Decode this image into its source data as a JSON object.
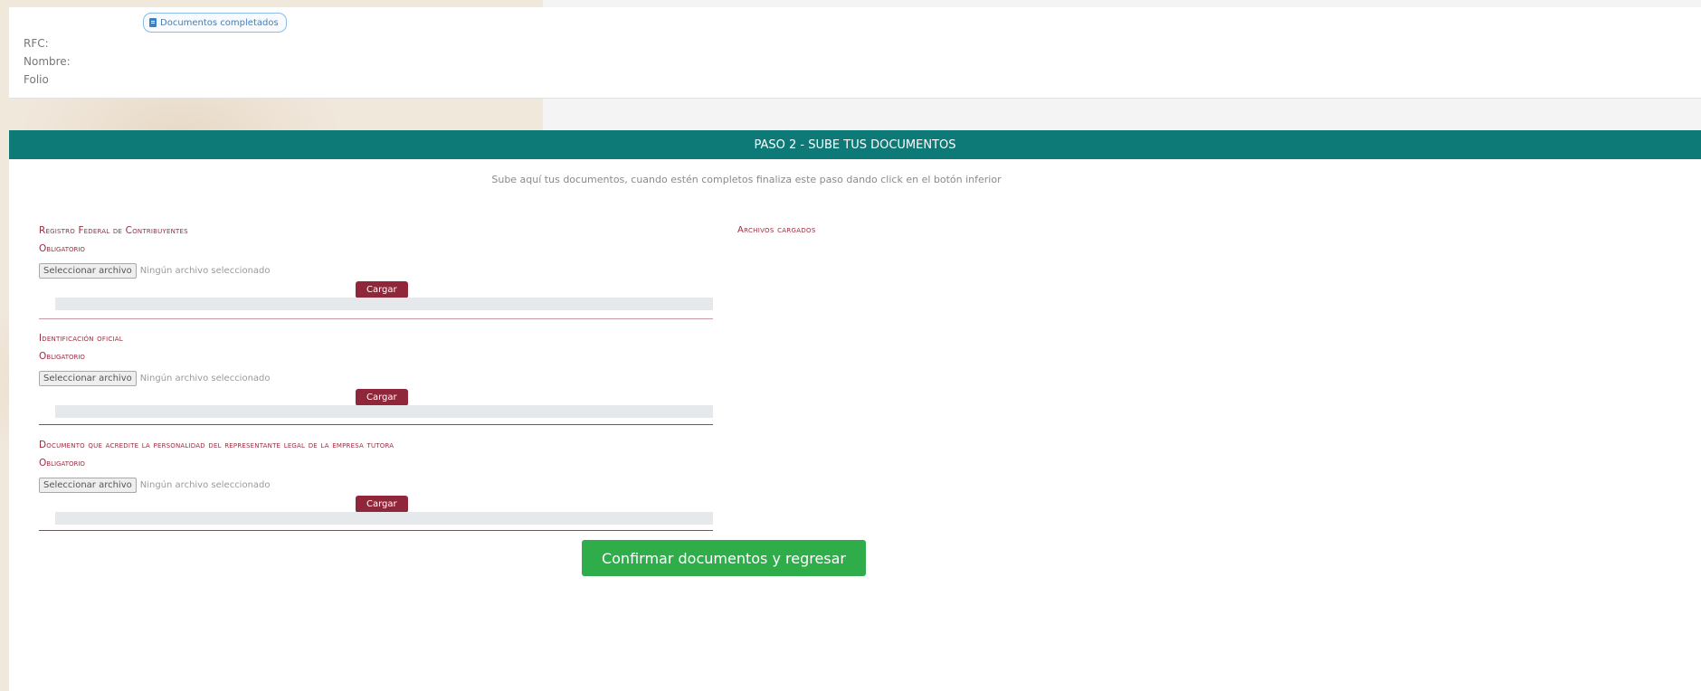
{
  "header": {
    "badge_label": "Documentos completados",
    "rfc_label": "RFC:",
    "nombre_label": "Nombre:",
    "folio_label": "Folio"
  },
  "step": {
    "title": "PASO 2 - SUBE TUS DOCUMENTOS",
    "instructions": "Sube aquí tus documentos, cuando estén completos finaliza este paso dando click en el botón inferior"
  },
  "uploaded_title": "Archivos cargados",
  "documents": [
    {
      "title": "Registro Federal de Contribuyentes",
      "required": "Obligatorio",
      "file_button": "Seleccionar archivo",
      "file_status": "Ningún archivo seleccionado",
      "upload_label": "Cargar"
    },
    {
      "title": "Identificación oficial",
      "required": "Obligatorio",
      "file_button": "Seleccionar archivo",
      "file_status": "Ningún archivo seleccionado",
      "upload_label": "Cargar"
    },
    {
      "title": "Documento que acredite la personalidad del representante legal de la empresa tutora",
      "required": "Obligatorio",
      "file_button": "Seleccionar archivo",
      "file_status": "Ningún archivo seleccionado",
      "upload_label": "Cargar"
    }
  ],
  "confirm_label": "Confirmar documentos y regresar",
  "colors": {
    "teal": "#0e7a77",
    "maroon": "#8f2639",
    "green": "#2fad4a",
    "link_blue": "#3c7fc2"
  }
}
